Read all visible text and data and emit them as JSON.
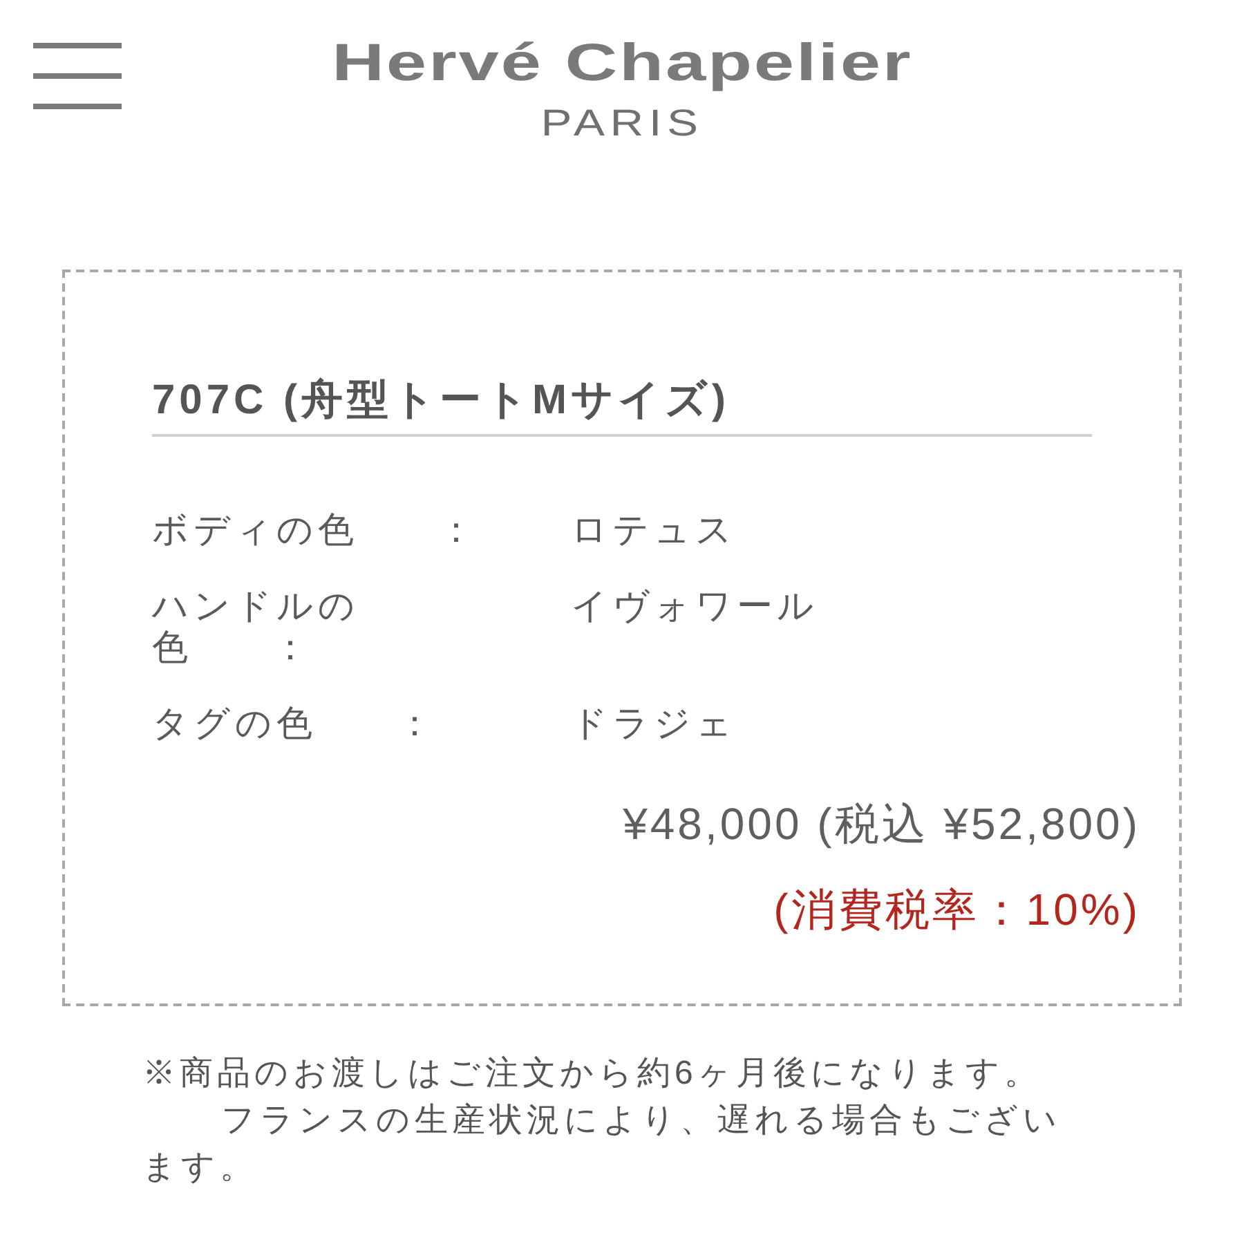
{
  "header": {
    "brand": "Hervé Chapelier",
    "subtitle": "PARIS"
  },
  "order": {
    "title": "707C (舟型トートMサイズ)",
    "specs": [
      {
        "label": "ボディの色　　：",
        "value": "ロテュス"
      },
      {
        "label": "ハンドルの色　　：",
        "value": "イヴォワール"
      },
      {
        "label": "タグの色　　：",
        "value": "ドラジェ"
      }
    ],
    "price": "¥48,000 (税込 ¥52,800)",
    "tax_rate": "(消費税率：10%)"
  },
  "note": [
    "※商品のお渡しはご注文から約6ヶ月後になります。",
    "フランスの生産状況により、遅れる場合もございます。"
  ]
}
